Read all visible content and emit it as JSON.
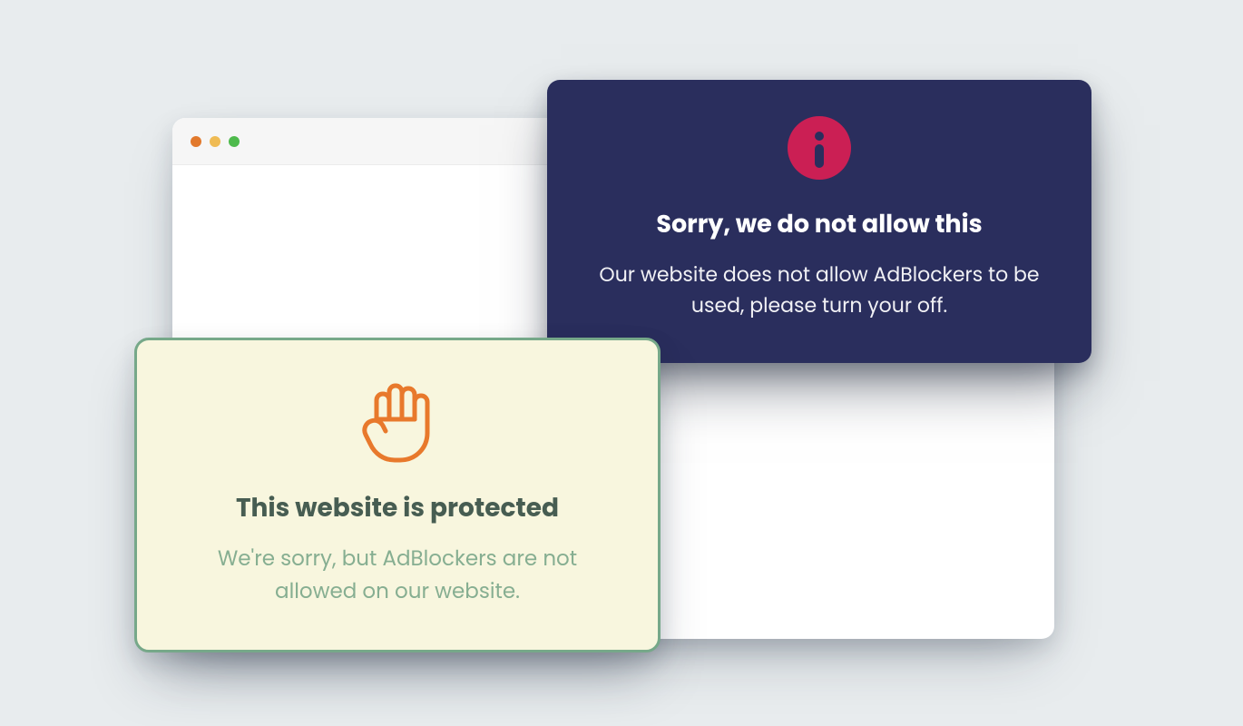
{
  "window": {
    "traffic_lights": {
      "red": "#e2792c",
      "yellow": "#efbb54",
      "green": "#4eba4c"
    }
  },
  "notice_dark": {
    "icon": "info-icon",
    "title": "Sorry, we do not allow this",
    "body": "Our website does not allow AdBlockers to be used, please turn your off."
  },
  "notice_light": {
    "icon": "hand-icon",
    "title": "This website is protected",
    "body": "We're sorry, but AdBlockers are not allowed on our website."
  }
}
